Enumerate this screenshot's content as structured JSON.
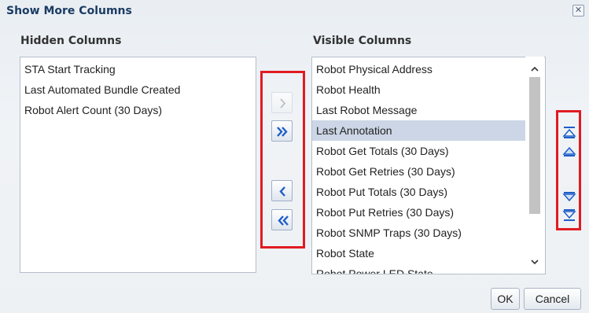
{
  "dialog": {
    "title": "Show More Columns",
    "close_icon": "close-icon"
  },
  "hidden": {
    "heading": "Hidden Columns",
    "items": [
      "STA Start Tracking",
      "Last Automated Bundle Created",
      "Robot Alert Count (30 Days)"
    ]
  },
  "visible": {
    "heading": "Visible Columns",
    "selected": "Last Annotation",
    "items": [
      "Robot Physical Address",
      "Robot Health",
      "Last Robot Message",
      "Last Annotation",
      "Robot Get Totals (30 Days)",
      "Robot Get Retries (30 Days)",
      "Robot Put Totals (30 Days)",
      "Robot Put Retries (30 Days)",
      "Robot SNMP Traps (30 Days)",
      "Robot State",
      "Robot Power LED State"
    ]
  },
  "shuttle": {
    "move_icon": "chevron-right-icon",
    "move_all_icon": "double-chevron-right-icon",
    "remove_icon": "chevron-left-icon",
    "remove_all_icon": "double-chevron-left-icon"
  },
  "reorder": {
    "top_icon": "move-to-top-icon",
    "up_icon": "move-up-icon",
    "down_icon": "move-down-icon",
    "bottom_icon": "move-to-bottom-icon"
  },
  "buttons": {
    "ok": "OK",
    "cancel": "Cancel"
  },
  "colors": {
    "title": "#1b3c63",
    "highlight_box": "#e11b22",
    "selection": "#ccd6e6",
    "icon_blue": "#1e5ec8"
  }
}
